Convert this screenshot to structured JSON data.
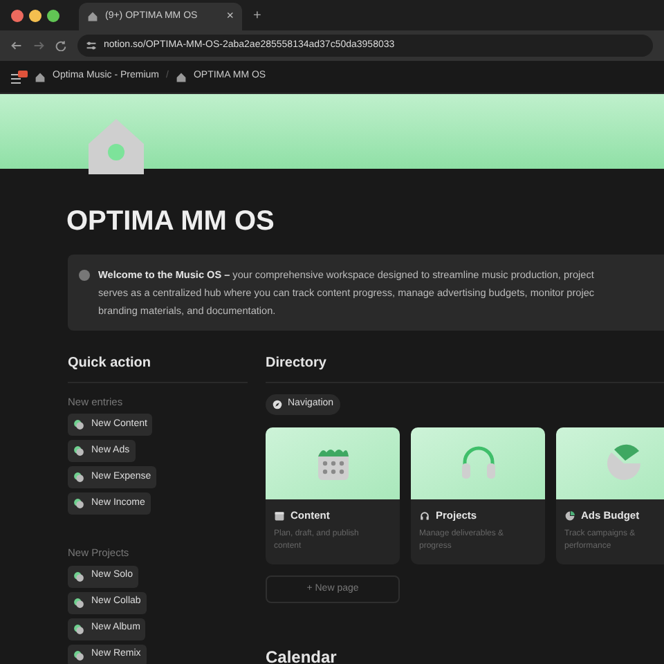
{
  "browser": {
    "tab": {
      "title": "(9+) OPTIMA MM OS",
      "close": "×"
    },
    "new_tab": "+",
    "url": "notion.so/OPTIMA-MM-OS-2aba2ae285558134ad37c50da3958033"
  },
  "breadcrumbs": {
    "items": [
      "Optima Music - Premium",
      "OPTIMA MM OS"
    ],
    "separator": "/"
  },
  "page": {
    "title": "OPTIMA MM OS",
    "callout": [
      "**Welcome to the Music OS –** your comprehensive workspace designed to streamline music production, project",
      "serves as a centralized hub where you can track content progress, manage advertising budgets, monitor projec",
      "branding materials, and documentation."
    ],
    "quick_action": {
      "heading": "Quick action",
      "groups": [
        {
          "label": "New entries",
          "buttons": [
            "New Content",
            "New Ads",
            "New Expense",
            "New Income"
          ]
        },
        {
          "label": "New Projects",
          "buttons": [
            "New Solo",
            "New Collab",
            "New Album",
            "New Remix"
          ]
        }
      ]
    },
    "directory": {
      "heading": "Directory",
      "tab": "Navigation",
      "cards": [
        {
          "kind": "calendar",
          "title": "Content",
          "description": "Plan, draft, and publish content"
        },
        {
          "kind": "headphones",
          "title": "Projects",
          "description": "Manage deliverables & progress"
        },
        {
          "kind": "pie",
          "title": "Ads Budget",
          "description": "Track campaigns & performance"
        }
      ],
      "new_page": "+ New page"
    },
    "calendar_heading": "Calendar"
  }
}
